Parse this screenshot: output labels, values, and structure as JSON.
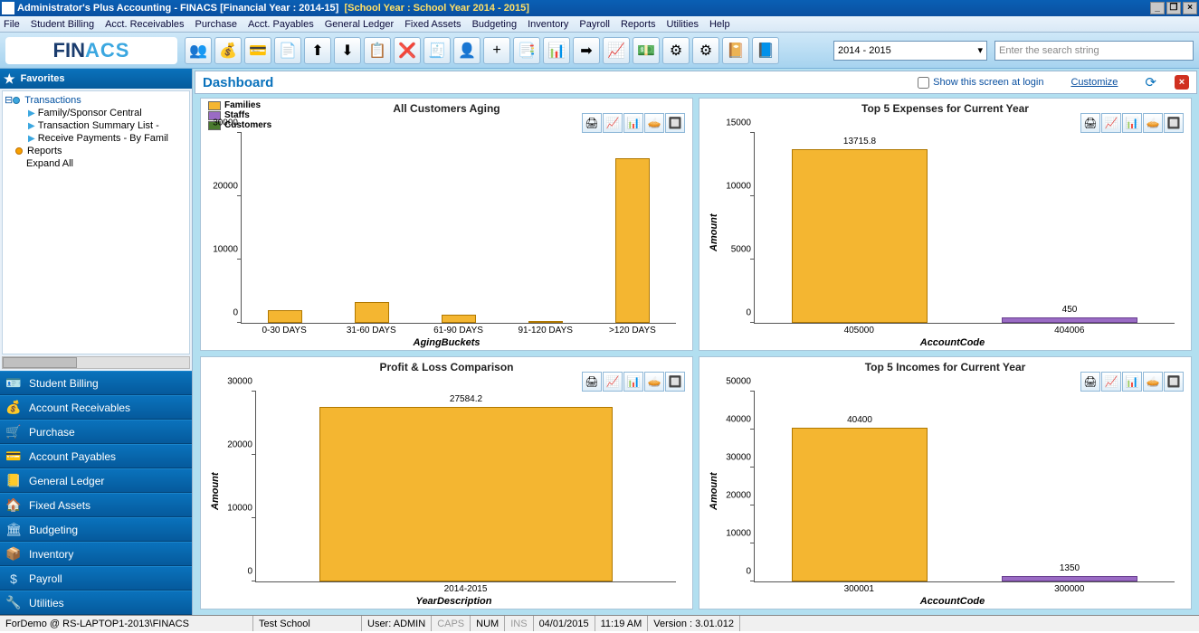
{
  "title": {
    "app": "Administrator's Plus Accounting - FINACS",
    "fy": "[Financial Year : 2014-15]",
    "sy": "[School Year : School Year 2014 - 2015]"
  },
  "menu": [
    "File",
    "Student Billing",
    "Acct. Receivables",
    "Purchase",
    "Acct. Payables",
    "General Ledger",
    "Fixed Assets",
    "Budgeting",
    "Inventory",
    "Payroll",
    "Reports",
    "Utilities",
    "Help"
  ],
  "logo": {
    "p1": "FIN",
    "p2": "ACS"
  },
  "toolbar": {
    "year": "2014 - 2015",
    "search_placeholder": "Enter the search string"
  },
  "sidebar": {
    "favorites": "Favorites",
    "tree": {
      "transactions": "Transactions",
      "items": [
        "Family/Sponsor Central",
        "Transaction Summary List -",
        "Receive Payments - By Famil"
      ],
      "reports": "Reports",
      "expand": "Expand All"
    },
    "modules": [
      "Student Billing",
      "Account Receivables",
      "Purchase",
      "Account Payables",
      "General Ledger",
      "Fixed Assets",
      "Budgeting",
      "Inventory",
      "Payroll",
      "Utilities"
    ]
  },
  "dashheader": {
    "title": "Dashboard",
    "show": "Show this screen at login",
    "customize": "Customize"
  },
  "chart_data": [
    {
      "type": "bar",
      "title": "All Customers Aging",
      "xlabel": "AgingBuckets",
      "ylabel": "",
      "ylim": [
        0,
        30000
      ],
      "yticks": [
        0,
        10000,
        20000,
        30000
      ],
      "categories": [
        "0-30 DAYS",
        "31-60 DAYS",
        "61-90 DAYS",
        "91-120 DAYS",
        ">120 DAYS"
      ],
      "series": [
        {
          "name": "Families",
          "color": "#f4b631",
          "values": [
            2000,
            3300,
            1300,
            0,
            26000
          ]
        }
      ],
      "legend": [
        "Families",
        "Staffs",
        "Customers"
      ],
      "legend_colors": [
        "#f4b631",
        "#9a6bc4",
        "#4a7a2e"
      ]
    },
    {
      "type": "bar",
      "title": "Top 5 Expenses for Current Year",
      "xlabel": "AccountCode",
      "ylabel": "Amount",
      "ylim": [
        0,
        15000
      ],
      "yticks": [
        0,
        5000,
        10000,
        15000
      ],
      "categories": [
        "405000",
        "404006"
      ],
      "values": [
        13715.8,
        450
      ],
      "colors": [
        "#f4b631",
        "#9a6bc4"
      ],
      "labels": [
        "13715.8",
        "450"
      ]
    },
    {
      "type": "bar",
      "title": "Profit & Loss Comparison",
      "xlabel": "YearDescription",
      "ylabel": "Amount",
      "ylim": [
        0,
        30000
      ],
      "yticks": [
        0,
        10000,
        20000,
        30000
      ],
      "categories": [
        "2014-2015"
      ],
      "values": [
        27584.2
      ],
      "colors": [
        "#f4b631"
      ],
      "labels": [
        "27584.2"
      ]
    },
    {
      "type": "bar",
      "title": "Top 5 Incomes for Current Year",
      "xlabel": "AccountCode",
      "ylabel": "Amount",
      "ylim": [
        0,
        50000
      ],
      "yticks": [
        0,
        10000,
        20000,
        30000,
        40000,
        50000
      ],
      "categories": [
        "300001",
        "300000"
      ],
      "values": [
        40400,
        1350
      ],
      "colors": [
        "#f4b631",
        "#9a6bc4"
      ],
      "labels": [
        "40400",
        "1350"
      ]
    }
  ],
  "status": {
    "demo": "ForDemo @ RS-LAPTOP1-2013\\FINACS",
    "school": "Test School",
    "user": "User: ADMIN",
    "caps": "CAPS",
    "num": "NUM",
    "ins": "INS",
    "date": "04/01/2015",
    "time": "11:19 AM",
    "version": "Version : 3.01.012"
  }
}
